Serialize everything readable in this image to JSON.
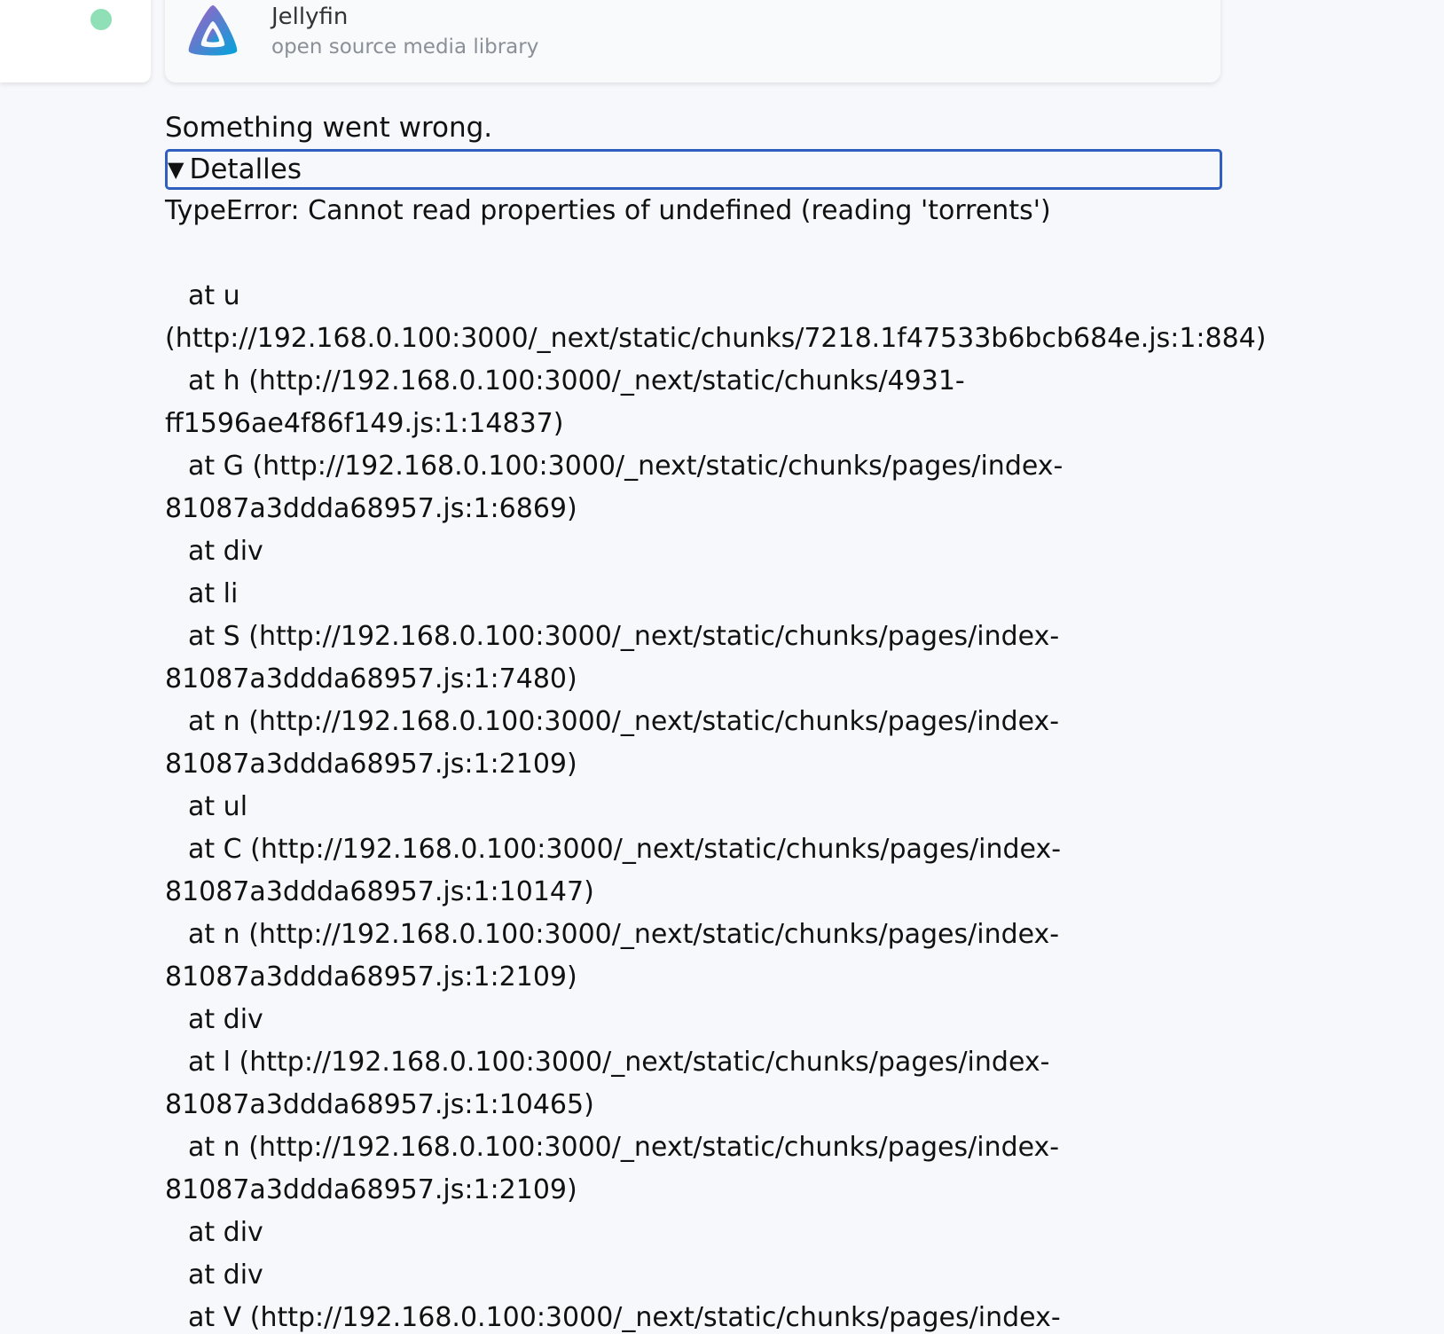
{
  "status_dot_color": "#8fe0b6",
  "brand": {
    "name": "Jellyfin",
    "subtitle": "open source media library",
    "logo_icon": "jellyfin-logo-icon",
    "logo_colors": [
      "#aa5cc3",
      "#00a4dc"
    ]
  },
  "error": {
    "title": "Something went wrong.",
    "details_label": "Detalles",
    "message": "TypeError: Cannot read properties of undefined (reading 'torrents')",
    "stack": [
      {
        "text": "at u",
        "indent": true
      },
      {
        "text": "(http://192.168.0.100:3000/_next/static/chunks/7218.1f47533b6bcb684e.js:1:884)",
        "indent": false
      },
      {
        "text": "at h (http://192.168.0.100:3000/_next/static/chunks/4931-",
        "indent": true
      },
      {
        "text": "ff1596ae4f86f149.js:1:14837)",
        "indent": false
      },
      {
        "text": "at G (http://192.168.0.100:3000/_next/static/chunks/pages/index-",
        "indent": true
      },
      {
        "text": "81087a3ddda68957.js:1:6869)",
        "indent": false
      },
      {
        "text": "at div",
        "indent": true
      },
      {
        "text": "at li",
        "indent": true
      },
      {
        "text": "at S (http://192.168.0.100:3000/_next/static/chunks/pages/index-",
        "indent": true
      },
      {
        "text": "81087a3ddda68957.js:1:7480)",
        "indent": false
      },
      {
        "text": "at n (http://192.168.0.100:3000/_next/static/chunks/pages/index-",
        "indent": true
      },
      {
        "text": "81087a3ddda68957.js:1:2109)",
        "indent": false
      },
      {
        "text": "at ul",
        "indent": true
      },
      {
        "text": "at C (http://192.168.0.100:3000/_next/static/chunks/pages/index-",
        "indent": true
      },
      {
        "text": "81087a3ddda68957.js:1:10147)",
        "indent": false
      },
      {
        "text": "at n (http://192.168.0.100:3000/_next/static/chunks/pages/index-",
        "indent": true
      },
      {
        "text": "81087a3ddda68957.js:1:2109)",
        "indent": false
      },
      {
        "text": "at div",
        "indent": true
      },
      {
        "text": "at l (http://192.168.0.100:3000/_next/static/chunks/pages/index-",
        "indent": true
      },
      {
        "text": "81087a3ddda68957.js:1:10465)",
        "indent": false
      },
      {
        "text": "at n (http://192.168.0.100:3000/_next/static/chunks/pages/index-",
        "indent": true
      },
      {
        "text": "81087a3ddda68957.js:1:2109)",
        "indent": false
      },
      {
        "text": "at div",
        "indent": true
      },
      {
        "text": "at div",
        "indent": true
      },
      {
        "text": "at V (http://192.168.0.100:3000/_next/static/chunks/pages/index-",
        "indent": true
      }
    ]
  }
}
